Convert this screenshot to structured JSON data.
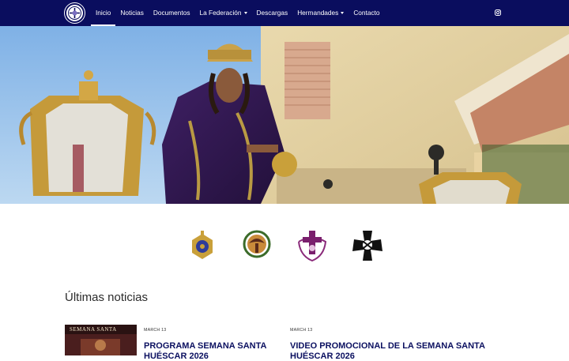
{
  "nav": {
    "items": [
      {
        "label": "Inicio",
        "active": true,
        "dropdown": false
      },
      {
        "label": "Noticias",
        "active": false,
        "dropdown": false
      },
      {
        "label": "Documentos",
        "active": false,
        "dropdown": false
      },
      {
        "label": "La Federación",
        "active": false,
        "dropdown": true
      },
      {
        "label": "Descargas",
        "active": false,
        "dropdown": false
      },
      {
        "label": "Hermandades",
        "active": false,
        "dropdown": true
      },
      {
        "label": "Contacto",
        "active": false,
        "dropdown": false
      }
    ],
    "social_icon": "instagram-icon"
  },
  "emblems": [
    "brotherhood-crest-blue-gold",
    "brotherhood-crest-green-wreath",
    "brotherhood-crest-purple-cross",
    "brotherhood-crest-black-cross"
  ],
  "news": {
    "section_title": "Últimas noticias",
    "posts": [
      {
        "date": "MARCH 13",
        "title": "PROGRAMA SEMANA SANTA",
        "title_line2": "HUÉSCAR 2026",
        "thumb_text": "SEMANA SANTA"
      },
      {
        "date": "MARCH 13",
        "title": "VIDEO PROMOCIONAL DE LA SEMANA SANTA",
        "title_line2": "HUÉSCAR 2026"
      }
    ]
  },
  "colors": {
    "navbar": "#0a0d5e",
    "title_blue": "#0b1060",
    "accent_gold": "#c9a03a",
    "accent_purple": "#5a1e73"
  }
}
